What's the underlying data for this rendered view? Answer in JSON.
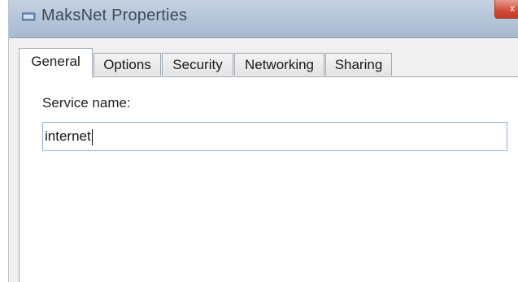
{
  "window": {
    "title": "MaksNet Properties",
    "close_symbol": "x"
  },
  "tabs": [
    {
      "label": "General",
      "active": true
    },
    {
      "label": "Options",
      "active": false
    },
    {
      "label": "Security",
      "active": false
    },
    {
      "label": "Networking",
      "active": false
    },
    {
      "label": "Sharing",
      "active": false
    }
  ],
  "general": {
    "service_name_label": "Service name:",
    "service_name_value": "internet"
  },
  "icons": {
    "title_icon": "network-connection-icon",
    "close_icon": "close-icon"
  },
  "colors": {
    "titlebar": "#b3c4d8",
    "close_button": "#d14b35",
    "field_border": "#8fb0cf"
  }
}
